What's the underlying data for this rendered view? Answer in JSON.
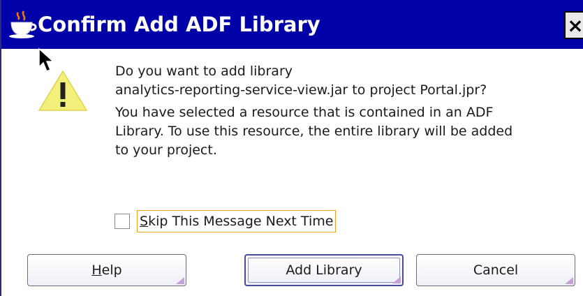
{
  "window": {
    "title": "Confirm Add ADF Library",
    "close_label": "×",
    "app_icon": "java-coffee-cup-icon"
  },
  "dialog": {
    "warning_icon": "warning-triangle-icon",
    "message_primary_line1": "Do you want to add library",
    "message_primary_line2": "analytics-reporting-service-view.jar to project Portal.jpr?",
    "message_secondary_line1": "You have selected a resource that is contained in an ADF",
    "message_secondary_line2": "Library. To use this resource, the entire library will be added",
    "message_secondary_line3": "to your project.",
    "checkbox": {
      "label_mnemonic": "S",
      "label_rest": "kip This Message Next Time",
      "checked": false
    }
  },
  "buttons": {
    "help_mnemonic": "H",
    "help_rest": "elp",
    "add_library": "Add Library",
    "cancel": "Cancel"
  },
  "colors": {
    "titlebar": "#0000a8",
    "focus_outline": "#f0a020"
  }
}
